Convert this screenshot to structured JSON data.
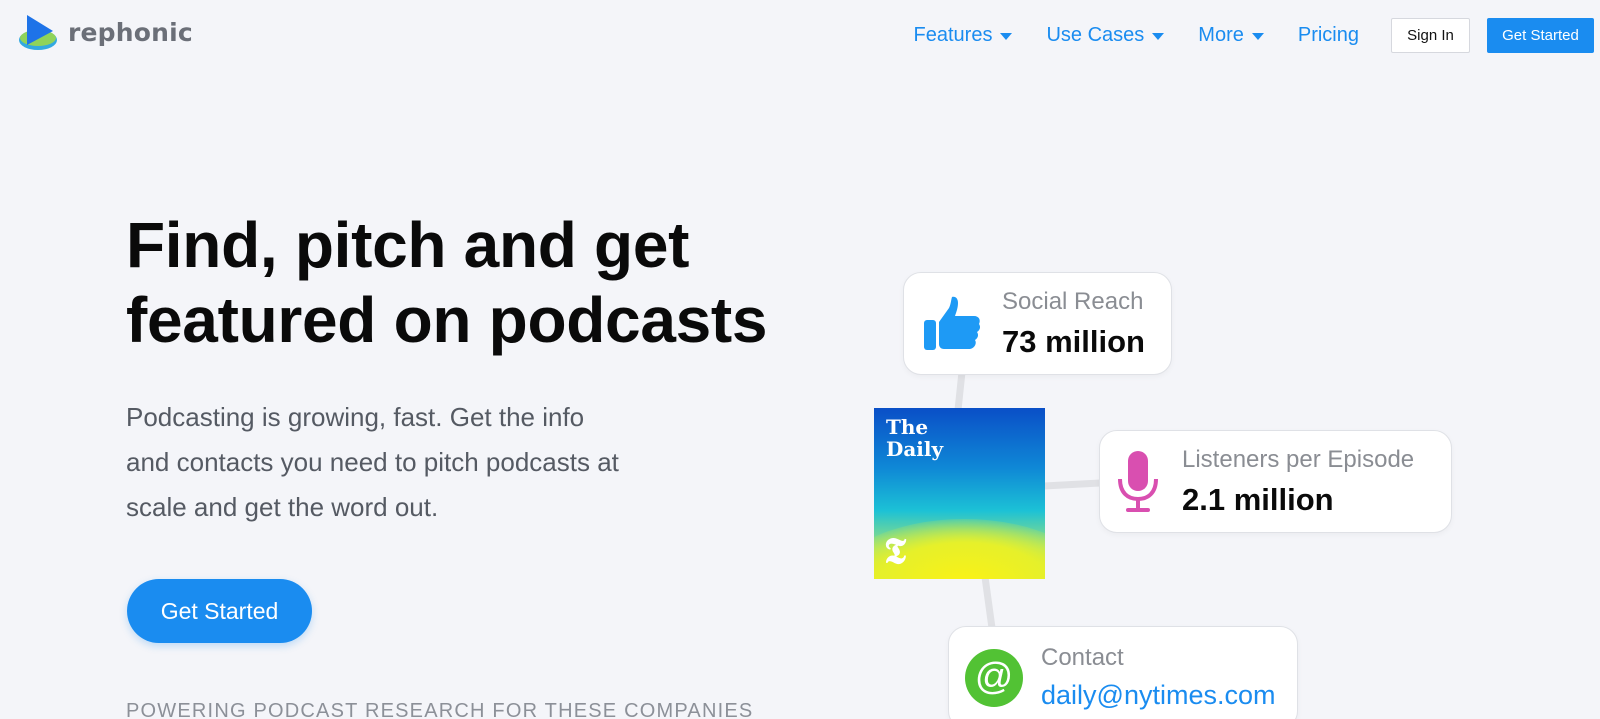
{
  "brand": {
    "name": "rephonic"
  },
  "nav": {
    "items": [
      {
        "label": "Features",
        "has_dropdown": true
      },
      {
        "label": "Use Cases",
        "has_dropdown": true
      },
      {
        "label": "More",
        "has_dropdown": true
      },
      {
        "label": "Pricing",
        "has_dropdown": false
      }
    ],
    "signin_label": "Sign In",
    "get_started_label": "Get Started"
  },
  "hero": {
    "title_line1": "Find, pitch and get",
    "title_line2": "featured on podcasts",
    "subtitle_line1": "Podcasting is growing, fast. Get the info",
    "subtitle_line2": "and contacts you need to pitch podcasts at",
    "subtitle_line3": "scale and get the word out.",
    "cta_label": "Get Started",
    "companies_heading": "POWERING PODCAST RESEARCH FOR THESE COMPANIES"
  },
  "graphic": {
    "cover": {
      "title_line1": "The",
      "title_line2": "Daily",
      "mark": "𝕿"
    },
    "social": {
      "icon": "thumbs-up-icon",
      "label": "Social Reach",
      "value": "73 million",
      "color": "#1e9af5"
    },
    "listeners": {
      "icon": "microphone-icon",
      "label": "Listeners per Episode",
      "value": "2.1 million",
      "color": "#d94fb0"
    },
    "contact": {
      "icon": "at-sign-icon",
      "label": "Contact",
      "value": "daily@nytimes.com",
      "color": "#52c234"
    }
  },
  "colors": {
    "accent": "#1a8cf0",
    "background": "#f4f5f9"
  }
}
